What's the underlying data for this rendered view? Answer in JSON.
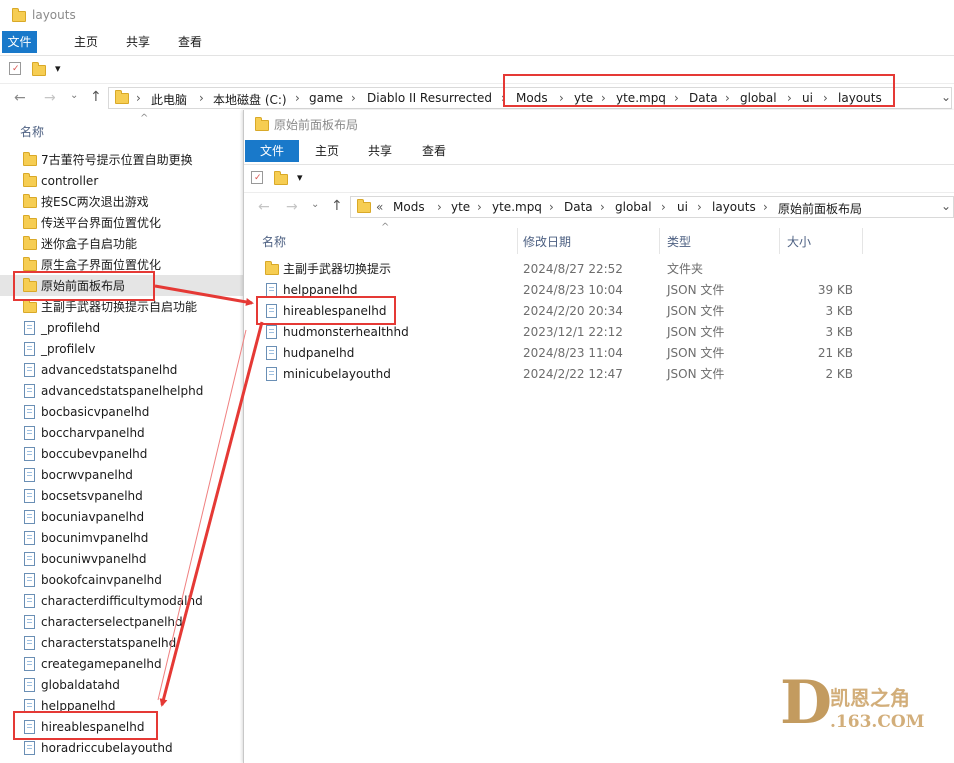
{
  "back_window": {
    "title": "layouts",
    "ribbon_tabs": [
      "文件",
      "主页",
      "共享",
      "查看"
    ],
    "qat_dropdown": "▾",
    "address": [
      "此电脑",
      "本地磁盘 (C:)",
      "game",
      "Diablo II Resurrected",
      "Mods",
      "yte",
      "yte.mpq",
      "Data",
      "global",
      "ui",
      "layouts"
    ],
    "column_name": "名称",
    "sort_indicator": "^",
    "items": [
      {
        "name": "7古董符号提示位置自助更换",
        "kind": "folder"
      },
      {
        "name": "controller",
        "kind": "folder"
      },
      {
        "name": "按ESC两次退出游戏",
        "kind": "folder"
      },
      {
        "name": "传送平台界面位置优化",
        "kind": "folder"
      },
      {
        "name": "迷你盒子自启功能",
        "kind": "folder"
      },
      {
        "name": "原生盒子界面位置优化",
        "kind": "folder"
      },
      {
        "name": "原始前面板布局",
        "kind": "folder"
      },
      {
        "name": "主副手武器切换提示自启功能",
        "kind": "folder"
      },
      {
        "name": "_profilehd",
        "kind": "file"
      },
      {
        "name": "_profilelv",
        "kind": "file"
      },
      {
        "name": "advancedstatspanelhd",
        "kind": "file"
      },
      {
        "name": "advancedstatspanelhelphd",
        "kind": "file"
      },
      {
        "name": "bocbasicvpanelhd",
        "kind": "file"
      },
      {
        "name": "boccharvpanelhd",
        "kind": "file"
      },
      {
        "name": "boccubevpanelhd",
        "kind": "file"
      },
      {
        "name": "bocrwvpanelhd",
        "kind": "file"
      },
      {
        "name": "bocsetsvpanelhd",
        "kind": "file"
      },
      {
        "name": "bocuniavpanelhd",
        "kind": "file"
      },
      {
        "name": "bocunimvpanelhd",
        "kind": "file"
      },
      {
        "name": "bocuniwvpanelhd",
        "kind": "file"
      },
      {
        "name": "bookofcainvpanelhd",
        "kind": "file"
      },
      {
        "name": "characterdifficultymodalhd",
        "kind": "file"
      },
      {
        "name": "characterselectpanelhd",
        "kind": "file"
      },
      {
        "name": "characterstatspanelhd",
        "kind": "file"
      },
      {
        "name": "creategamepanelhd",
        "kind": "file"
      },
      {
        "name": "globaldatahd",
        "kind": "file"
      },
      {
        "name": "helppanelhd",
        "kind": "file"
      },
      {
        "name": "hireablespanelhd",
        "kind": "file"
      },
      {
        "name": "horadriccubelayouthd",
        "kind": "file"
      }
    ]
  },
  "front_window": {
    "title": "原始前面板布局",
    "ribbon_tabs": [
      "文件",
      "主页",
      "共享",
      "查看"
    ],
    "qat_dropdown": "▾",
    "address_prefix": "«",
    "address": [
      "Mods",
      "yte",
      "yte.mpq",
      "Data",
      "global",
      "ui",
      "layouts",
      "原始前面板布局"
    ],
    "columns": {
      "name": "名称",
      "modified": "修改日期",
      "type": "类型",
      "size": "大小"
    },
    "sort_indicator": "^",
    "rows": [
      {
        "name": "主副手武器切换提示",
        "modified": "2024/8/27 22:52",
        "type": "文件夹",
        "size": "",
        "kind": "folder"
      },
      {
        "name": "helppanelhd",
        "modified": "2024/8/23 10:04",
        "type": "JSON 文件",
        "size": "39 KB",
        "kind": "file"
      },
      {
        "name": "hireablespanelhd",
        "modified": "2024/2/20 20:34",
        "type": "JSON 文件",
        "size": "3 KB",
        "kind": "file"
      },
      {
        "name": "hudmonsterhealthhd",
        "modified": "2023/12/1 22:12",
        "type": "JSON 文件",
        "size": "3 KB",
        "kind": "file"
      },
      {
        "name": "hudpanelhd",
        "modified": "2024/8/23 11:04",
        "type": "JSON 文件",
        "size": "21 KB",
        "kind": "file"
      },
      {
        "name": "minicubelayouthd",
        "modified": "2024/2/22 12:47",
        "type": "JSON 文件",
        "size": "2 KB",
        "kind": "file"
      }
    ]
  },
  "watermark": {
    "brand": "凯恩之角",
    "domain": ".163.COM",
    "letter": "D"
  },
  "colors": {
    "accent": "#1979ca",
    "highlight": "#e53935",
    "selection": "#e5e5e5",
    "folder": "#f6cd52"
  },
  "icons": [
    "back-arrow-icon",
    "forward-arrow-icon",
    "recent-dropdown-icon",
    "up-arrow-icon",
    "folder-icon",
    "json-file-icon",
    "properties-icon",
    "chevron-down-icon"
  ]
}
